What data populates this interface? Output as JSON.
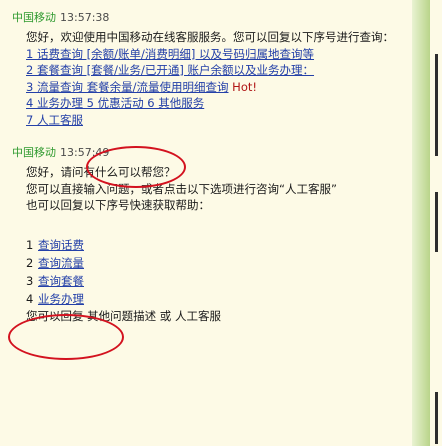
{
  "messages": [
    {
      "sender": "中国移动",
      "time": "13:57:38",
      "lines": [
        "您好，欢迎使用中国移动在线客服服务。您可以回复以下序号进行查询：",
        "1 话费查询 [余额/账单/消费明细] 以及号码归属地查询等",
        "2 套餐查询 [套餐/业务/已开通] 账户余额以及业务办理：",
        "3 流量查询 套餐余量/流量使用明细查询",
        "4 业务办理 5 优惠活动 6 其他服务"
      ],
      "hot_label": "Hot!",
      "human_agent": "7 人工客服"
    },
    {
      "sender": "中国移动",
      "time": "13:57:49",
      "lines": [
        "您好，请问有什么可以帮您？",
        "您可以直接输入问题，或者点击以下选项进行咨询“人工客服”",
        "也可以回复以下序号快速获取帮助："
      ],
      "options": [
        {
          "num": "1",
          "label": "查询话费"
        },
        {
          "num": "2",
          "label": "查询流量"
        },
        {
          "num": "3",
          "label": "查询套餐"
        },
        {
          "num": "4",
          "label": "业务办理"
        }
      ],
      "footer": "您可以回复 其他问题描述 或 人工客服"
    }
  ]
}
